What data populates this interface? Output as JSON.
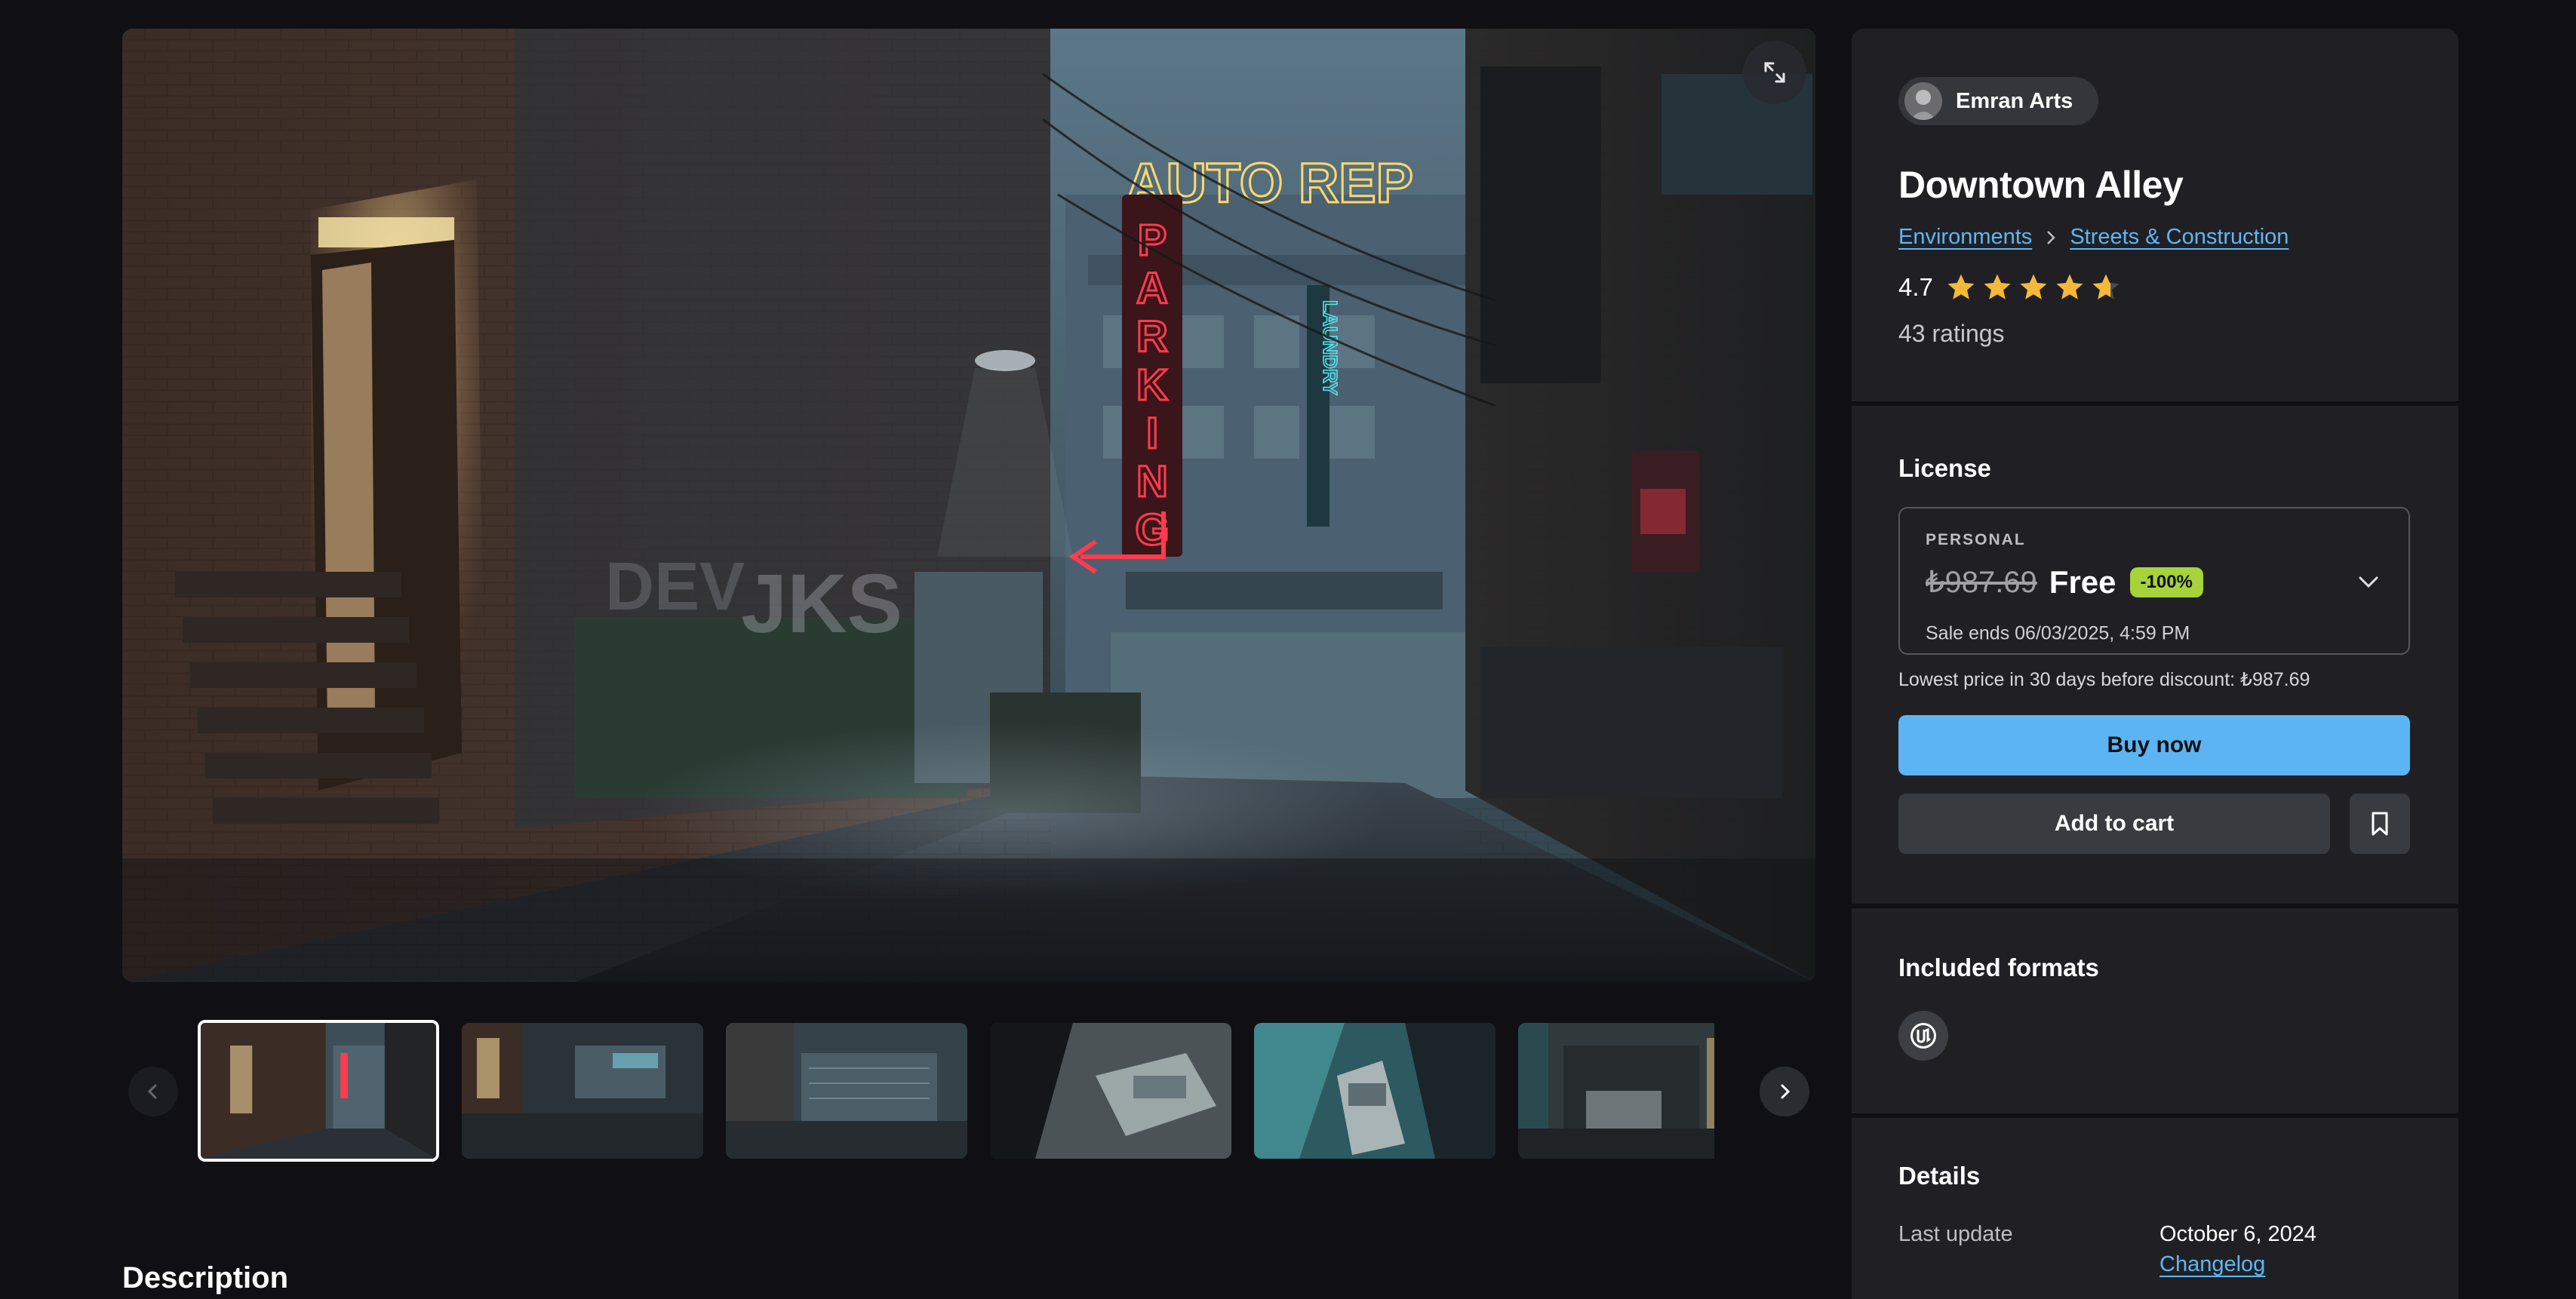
{
  "product": {
    "seller": "Emran Arts",
    "title": "Downtown Alley",
    "breadcrumb": [
      "Environments",
      "Streets & Construction"
    ],
    "rating": "4.7",
    "rating_fraction": 0.94,
    "ratings_count": "43 ratings"
  },
  "scene_signs": {
    "auto_repair": "AUTO REP",
    "parking": [
      "P",
      "A",
      "R",
      "K",
      "I",
      "N",
      "G"
    ],
    "laundry": "LAUNDRY"
  },
  "license": {
    "label": "License",
    "tier": "PERSONAL",
    "old_price": "₺987.69",
    "price": "Free",
    "discount": "-100%",
    "sale_ends": "Sale ends 06/03/2025, 4:59 PM",
    "lowest_note": "Lowest price in 30 days before discount: ₺987.69"
  },
  "actions": {
    "buy": "Buy now",
    "add_to_cart": "Add to cart"
  },
  "formats": {
    "label": "Included formats",
    "items": [
      "unreal-engine-icon"
    ]
  },
  "details": {
    "label": "Details",
    "last_update_key": "Last update",
    "last_update_val": "October 6, 2024",
    "changelog": "Changelog"
  },
  "description_heading": "Description",
  "thumbnails": {
    "count": 6,
    "active_index": 0
  },
  "colors": {
    "accent": "#5cb4f2",
    "badge": "#a6d23a",
    "star": "#f5b93a",
    "neon_red": "#ff3b4e",
    "neon_yellow": "#ffd96b",
    "neon_cyan": "#4fe4ef"
  }
}
